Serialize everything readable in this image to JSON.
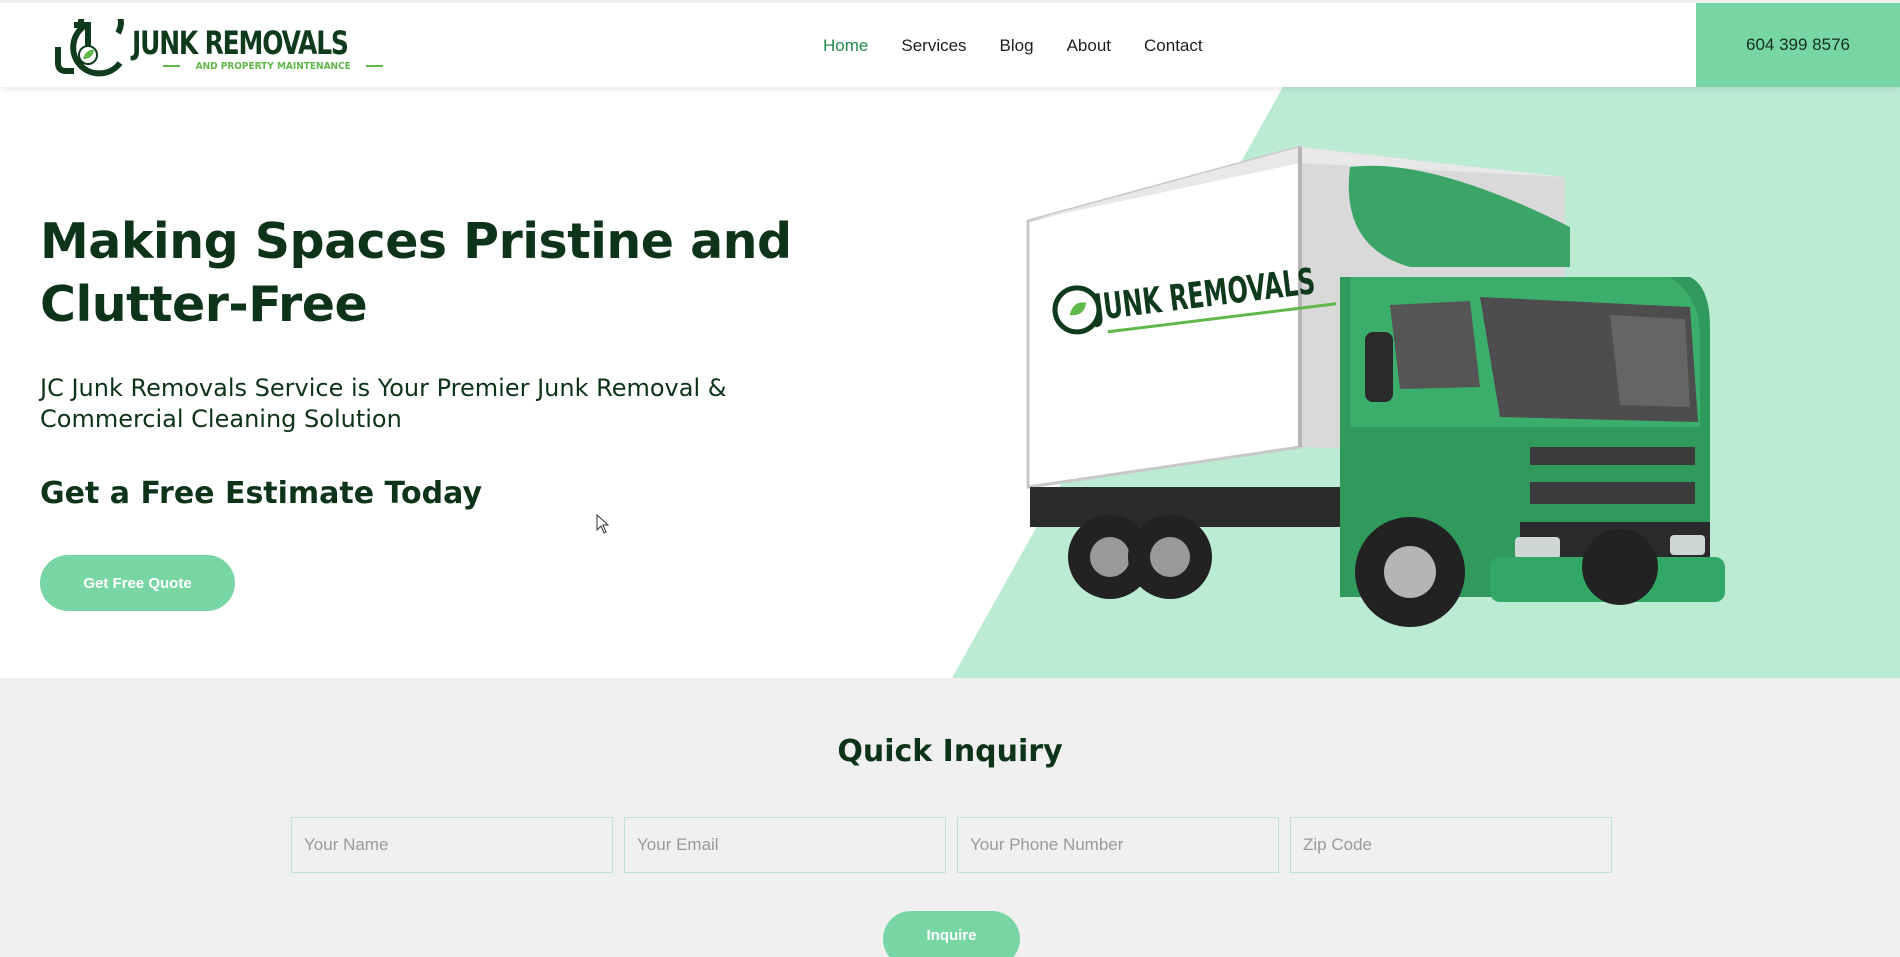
{
  "brand": {
    "name": "JUNK REMOVALS",
    "tagline": "AND PROPERTY MAINTENANCE",
    "monogram": "JC",
    "colors": {
      "primary_green": "#77d6a3",
      "dark_green": "#0d3319",
      "accent_green": "#5fb84a",
      "nav_active": "#1e8a4a"
    }
  },
  "nav": {
    "items": [
      {
        "label": "Home",
        "active": true
      },
      {
        "label": "Services",
        "active": false
      },
      {
        "label": "Blog",
        "active": false
      },
      {
        "label": "About",
        "active": false
      },
      {
        "label": "Contact",
        "active": false
      }
    ]
  },
  "header": {
    "phone": "604 399 8576"
  },
  "hero": {
    "title_line1": "Making Spaces Pristine and",
    "title_line2": "Clutter-Free",
    "subtitle_line1": "JC Junk Removals Service is Your Premier Junk Removal &",
    "subtitle_line2": "Commercial Cleaning Solution",
    "estimate_heading": "Get a Free Estimate Today",
    "cta_label": "Get Free Quote",
    "image": "green-box-truck-with-logo"
  },
  "inquiry": {
    "title": "Quick Inquiry",
    "fields": [
      {
        "placeholder": "Your Name",
        "value": ""
      },
      {
        "placeholder": "Your Email",
        "value": ""
      },
      {
        "placeholder": "Your Phone Number",
        "value": ""
      },
      {
        "placeholder": "Zip Code",
        "value": ""
      }
    ],
    "submit_label": "Inquire"
  }
}
